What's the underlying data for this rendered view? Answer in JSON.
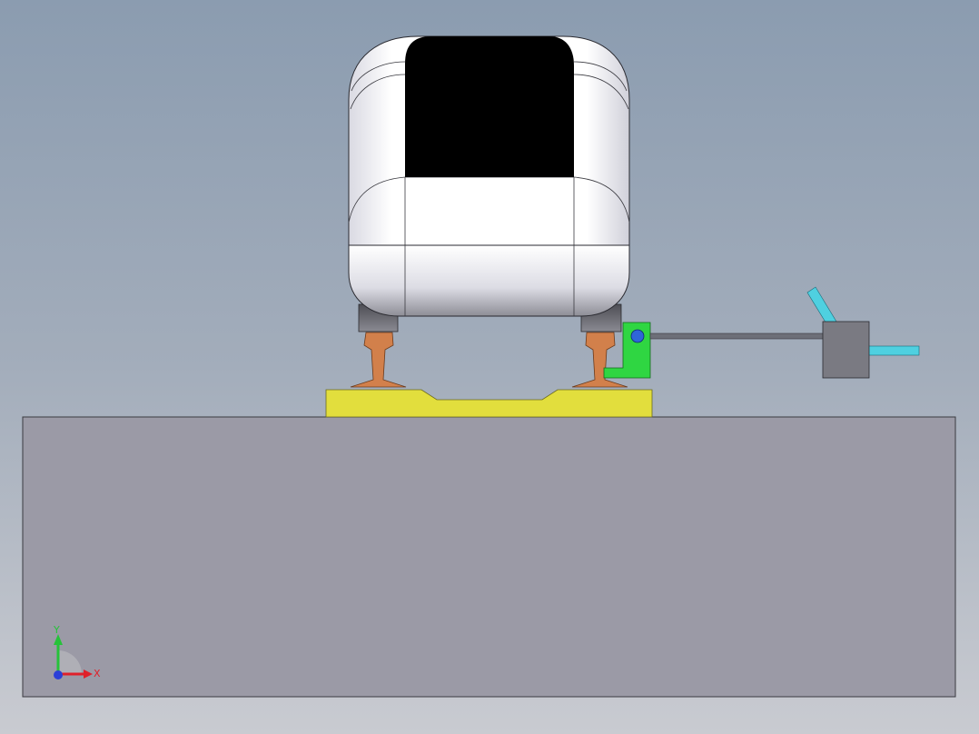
{
  "viewport": {
    "background_top": "#8b9cb0",
    "background_bottom": "#c9cbd1"
  },
  "scene": {
    "ground_block_color": "#9b9aa6",
    "track_base_color": "#e2de3d",
    "rail_color": "#d2804b",
    "vehicle_body_color": "#f4f4f8",
    "window_color": "#000000",
    "bogie_color": "#6d6d73",
    "bracket_color": "#2fd642",
    "pivot_color": "#2f66d8",
    "rod_color": "#6d6f78",
    "sensor_box_color": "#7a7a82",
    "sensor_arm_color": "#4fd0e0"
  },
  "triad": {
    "x_label": "X",
    "y_label": "Y",
    "x_color": "#e0202a",
    "y_color": "#26c23a",
    "z_color": "#2b3fd8"
  }
}
